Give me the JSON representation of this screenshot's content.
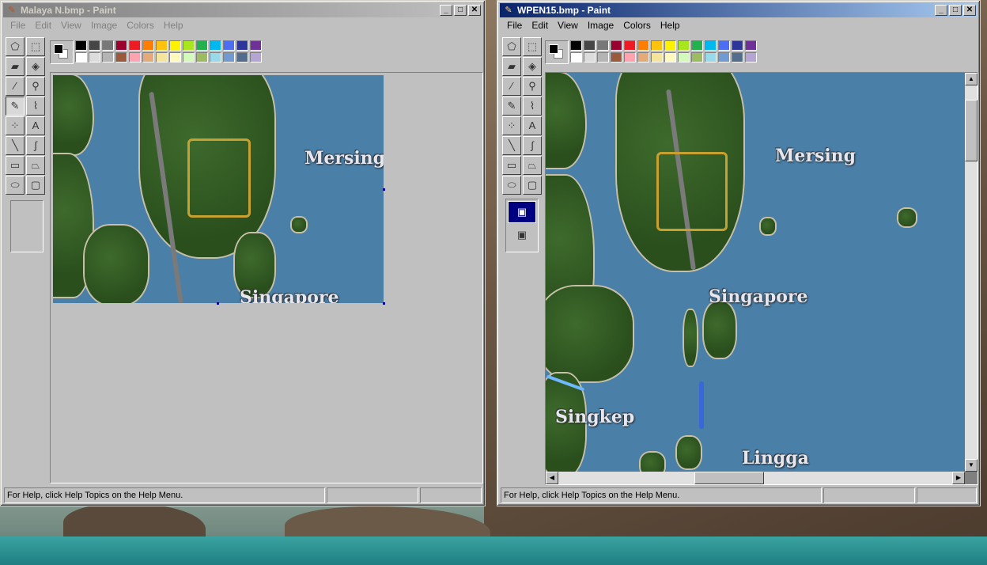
{
  "left_window": {
    "title": "Malaya N.bmp - Paint",
    "menu": [
      "File",
      "Edit",
      "View",
      "Image",
      "Colors",
      "Help"
    ],
    "status": "For Help, click Help Topics on the Help Menu.",
    "map_labels": {
      "mersing": "Mersing",
      "singapore": "Singapore"
    }
  },
  "right_window": {
    "title": "WPEN15.bmp - Paint",
    "menu": [
      "File",
      "Edit",
      "View",
      "Image",
      "Colors",
      "Help"
    ],
    "status": "For Help, click Help Topics on the Help Menu.",
    "map_labels": {
      "mersing": "Mersing",
      "singapore": "Singapore",
      "singkep": "Singkep",
      "lingga": "Lingga"
    }
  },
  "title_buttons": {
    "minimize": "_",
    "maximize": "□",
    "close": "✕"
  },
  "tools": [
    {
      "icon": "free-select-icon",
      "glyph": "⬠"
    },
    {
      "icon": "select-icon",
      "glyph": "⬚"
    },
    {
      "icon": "eraser-icon",
      "glyph": "▰"
    },
    {
      "icon": "fill-icon",
      "glyph": "◈"
    },
    {
      "icon": "pick-color-icon",
      "glyph": "⁄"
    },
    {
      "icon": "magnifier-icon",
      "glyph": "⚲"
    },
    {
      "icon": "pencil-icon",
      "glyph": "✎"
    },
    {
      "icon": "brush-icon",
      "glyph": "⌇"
    },
    {
      "icon": "airbrush-icon",
      "glyph": "⁘"
    },
    {
      "icon": "text-icon",
      "glyph": "A"
    },
    {
      "icon": "line-icon",
      "glyph": "╲"
    },
    {
      "icon": "curve-icon",
      "glyph": "∫"
    },
    {
      "icon": "rectangle-icon",
      "glyph": "▭"
    },
    {
      "icon": "polygon-icon",
      "glyph": "⏢"
    },
    {
      "icon": "ellipse-icon",
      "glyph": "⬭"
    },
    {
      "icon": "rounded-rect-icon",
      "glyph": "▢"
    }
  ],
  "palette": {
    "row1": [
      "#000000",
      "#808080",
      "#800000",
      "#808000",
      "#008000",
      "#008080",
      "#000080",
      "#800080",
      "#808040",
      "#004040",
      "#0080ff",
      "#004080",
      "#8000ff",
      "#804000"
    ],
    "row2": [
      "#ffffff",
      "#c0c0c0",
      "#ff0000",
      "#ffff00",
      "#00ff00",
      "#00ffff",
      "#0000ff",
      "#ff00ff",
      "#ffff80",
      "#00ff80",
      "#80ffff",
      "#8080ff",
      "#ff0080",
      "#ff8040"
    ],
    "row1_display": [
      "#000000",
      "#464646",
      "#787878",
      "#990030",
      "#ed1c24",
      "#ff7e00",
      "#ffc20e",
      "#fff200",
      "#a8e61d",
      "#22b14c",
      "#00b7ef",
      "#4d6df3",
      "#2f3699",
      "#6f3198"
    ],
    "row2_display": [
      "#ffffff",
      "#dcdcdc",
      "#b4b4b4",
      "#9c5a3c",
      "#ffa3b1",
      "#e5aa7a",
      "#f5e49c",
      "#fff9bd",
      "#d3f9bc",
      "#9dbb61",
      "#99d9ea",
      "#709ad1",
      "#546d8e",
      "#b5a5d5"
    ]
  },
  "colors": {
    "titlebar_active_start": "#0a246a",
    "titlebar_inactive_start": "#808080",
    "window_face": "#c0c0c0",
    "sea": "#4a7fa8"
  }
}
